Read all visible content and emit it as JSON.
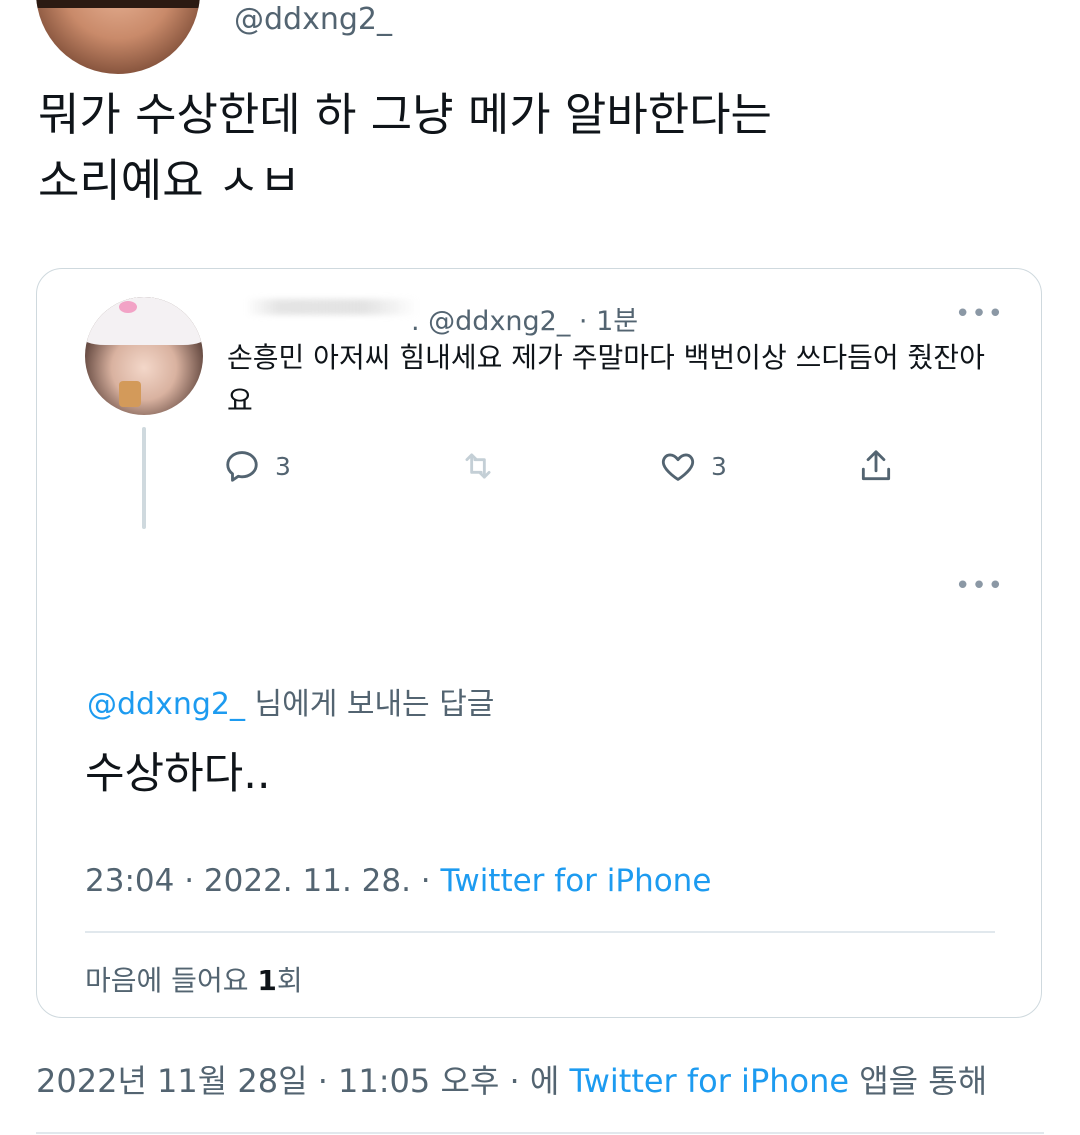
{
  "outer_tweet": {
    "handle": "@ddxng2_",
    "text": "뭐가 수상한데 하 그냥 메가 알바한다는\n소리예요 ㅅㅂ"
  },
  "quoted": {
    "meta": ". @ddxng2_ · 1분",
    "text": "손흥민 아저씨 힘내세요 제가 주말마다 백번이상 쓰다듬어 줬잔아요",
    "reply_count": "3",
    "like_count": "3",
    "more": "•••",
    "reply_to_mention": "@ddxng2_",
    "reply_to_suffix": " 님에게 보내는 답글",
    "reply_text": "수상하다..",
    "timestamp": "23:04 · 2022. 11. 28. · ",
    "source": "Twitter for iPhone",
    "likes_prefix": "마음에 들어요 ",
    "likes_num": "1",
    "likes_suffix": "회"
  },
  "footer": {
    "date": "2022년 11월 28일 · 11:05 오후 · 에 ",
    "source": "Twitter for iPhone",
    "suffix": " 앱을 통해"
  },
  "icons": [
    "reply-icon",
    "retweet-icon",
    "like-icon",
    "share-icon",
    "more-icon"
  ],
  "colors": {
    "link": "#1d9bf0",
    "secondary": "#536471",
    "text": "#0f1419",
    "border": "#cfd9de"
  }
}
